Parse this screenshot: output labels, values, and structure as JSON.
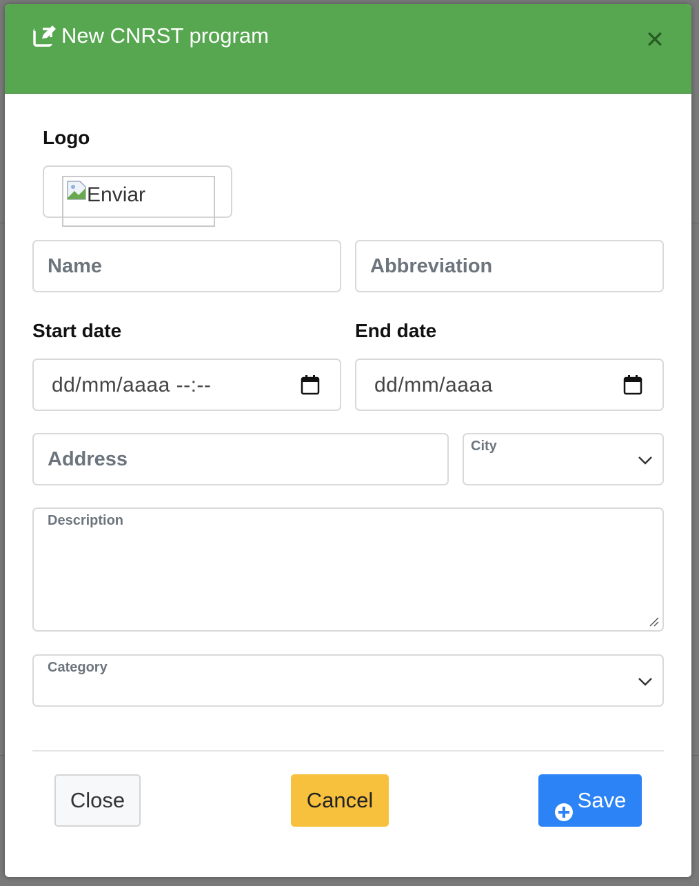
{
  "modal": {
    "title": "New CNRST program",
    "header_color": "#57a751"
  },
  "form": {
    "logo_label": "Logo",
    "logo_alt": "Enviar",
    "name_placeholder": "Name",
    "abbreviation_placeholder": "Abbreviation",
    "start_date_label": "Start date",
    "start_date_value": "dd/mm/aaaa --:--",
    "end_date_label": "End date",
    "end_date_value": "dd/mm/aaaa",
    "address_placeholder": "Address",
    "city_label": "City",
    "description_label": "Description",
    "category_label": "Category"
  },
  "footer": {
    "close_label": "Close",
    "cancel_label": "Cancel",
    "save_label": "Save"
  },
  "icons": {
    "header": "edit-icon",
    "close": "close-icon",
    "calendar": "calendar-icon",
    "chevron": "chevron-down-icon",
    "save": "plus-circle-icon"
  },
  "colors": {
    "save": "#2b83f6",
    "cancel": "#f7c13e",
    "header": "#57a751"
  }
}
